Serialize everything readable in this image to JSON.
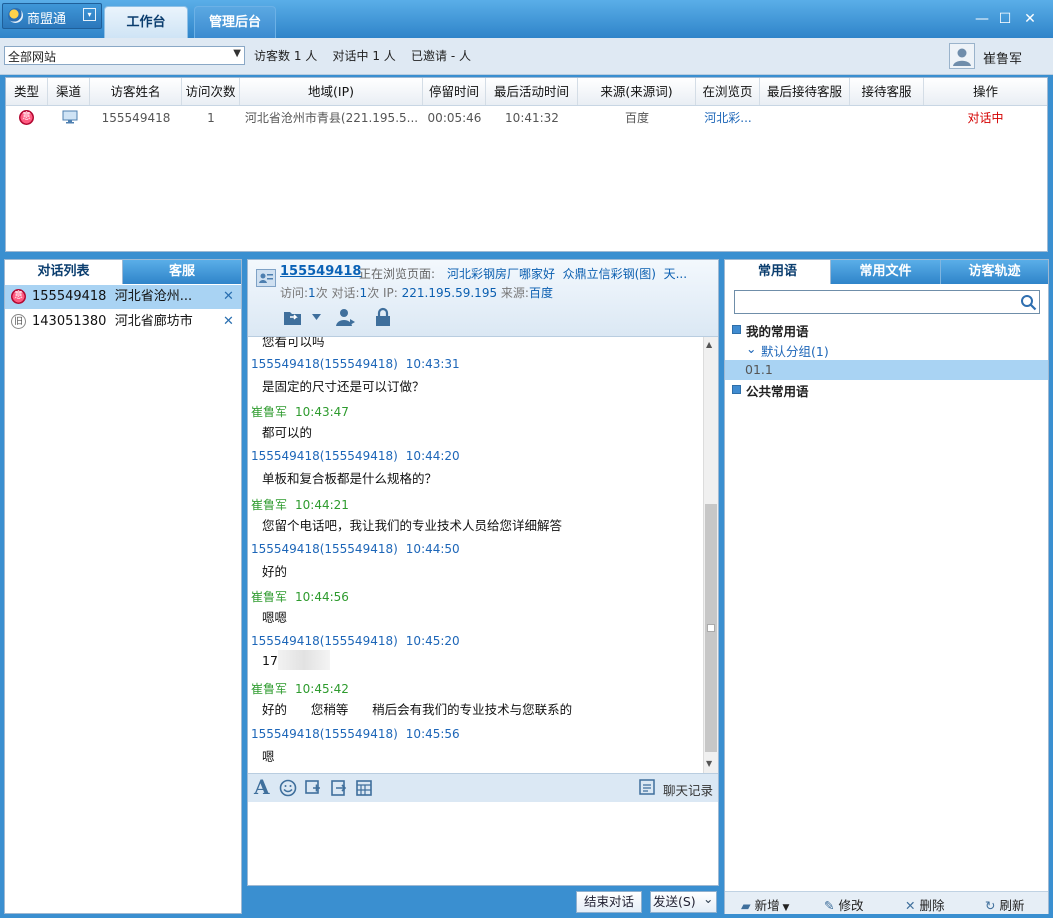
{
  "app": {
    "name": "商盟通",
    "menu_icon": "▾"
  },
  "tabs": {
    "workbench": "工作台",
    "admin": "管理后台"
  },
  "window": {
    "minimize": "—",
    "maximize": "☐",
    "close": "✕"
  },
  "toolbar": {
    "site_select": "全部网站",
    "stats": "访客数 1 人    对话中 1 人    已邀请 - 人",
    "user_name": "崔鲁军"
  },
  "visitor_table": {
    "columns": [
      "类型",
      "渠道",
      "访客姓名",
      "访问次数",
      "地域(IP)",
      "停留时间",
      "最后活动时间",
      "来源(来源词)",
      "在浏览页",
      "最后接待客服",
      "接待客服",
      "操作"
    ],
    "rows": [
      {
        "type_badge": "意",
        "name": "155549418",
        "visits": "1",
        "region": "河北省沧州市青县(221.195.5...",
        "stay": "00:05:46",
        "last_active": "10:41:32",
        "source": "百度",
        "browsing": "河北彩...",
        "last_agent": "",
        "agent": "",
        "action": "对话中"
      }
    ]
  },
  "left_panel": {
    "tab_list": "对话列表",
    "tab_staff": "客服",
    "conversations": [
      {
        "badge": "意",
        "text": "155549418  河北省沧州...",
        "close": "✕"
      },
      {
        "badge": "旧",
        "text": "143051380  河北省廊坊市",
        "close": "✕"
      }
    ]
  },
  "chat": {
    "visitor_name": "155549418",
    "browsing_label": "正在浏览页面:",
    "browsing_page": "河北彩钢房厂哪家好  众鼎立信彩钢(图)  天...",
    "info": {
      "visit_label": "访问:",
      "visits": "1",
      "visit_unit": "次 对话:",
      "talks": "1",
      "talk_unit": "次 IP:",
      "ip": "221.195.59.195",
      "source_label": "来源:",
      "source": "百度"
    },
    "cut_text": "您看可以吗",
    "messages": [
      {
        "sender": "155549418(155549418)",
        "time": "10:43:31",
        "role": "visitor",
        "text": "是固定的尺寸还是可以订做？"
      },
      {
        "sender": "崔鲁军",
        "time": "10:43:47",
        "role": "agent",
        "text": "都可以的"
      },
      {
        "sender": "155549418(155549418)",
        "time": "10:44:20",
        "role": "visitor",
        "text": "单板和复合板都是什么规格的？"
      },
      {
        "sender": "崔鲁军",
        "time": "10:44:21",
        "role": "agent",
        "text": "您留个电话吧，我让我们的专业技术人员给您详细解答"
      },
      {
        "sender": "155549418(155549418)",
        "time": "10:44:50",
        "role": "visitor",
        "text": "好的"
      },
      {
        "sender": "崔鲁军",
        "time": "10:44:56",
        "role": "agent",
        "text": "嗯嗯"
      },
      {
        "sender": "155549418(155549418)",
        "time": "10:45:20",
        "role": "visitor",
        "text": "17"
      },
      {
        "sender": "崔鲁军",
        "time": "10:45:42",
        "role": "agent",
        "text": "好的      您稍等      稍后会有我们的专业技术与您联系的"
      },
      {
        "sender": "155549418(155549418)",
        "time": "10:45:56",
        "role": "visitor",
        "text": "嗯"
      }
    ],
    "history_label": "聊天记录",
    "end_button": "结束对话",
    "send_button": "发送(S)",
    "send_arrow": "⌄"
  },
  "right_panel": {
    "tab_phrases": "常用语",
    "tab_files": "常用文件",
    "tab_track": "访客轨迹",
    "search_value": "",
    "my_phrases": "我的常用语",
    "default_group": "默认分组(1)",
    "phrase_item": "01.1",
    "public_phrases": "公共常用语",
    "footer": {
      "add": "新增",
      "edit": "修改",
      "delete": "删除",
      "refresh": "刷新"
    }
  },
  "colors": {
    "accent": "#2f84c9",
    "visitor": "#1d66b8",
    "agent": "#2e9b2e",
    "active_status": "#d40000"
  }
}
